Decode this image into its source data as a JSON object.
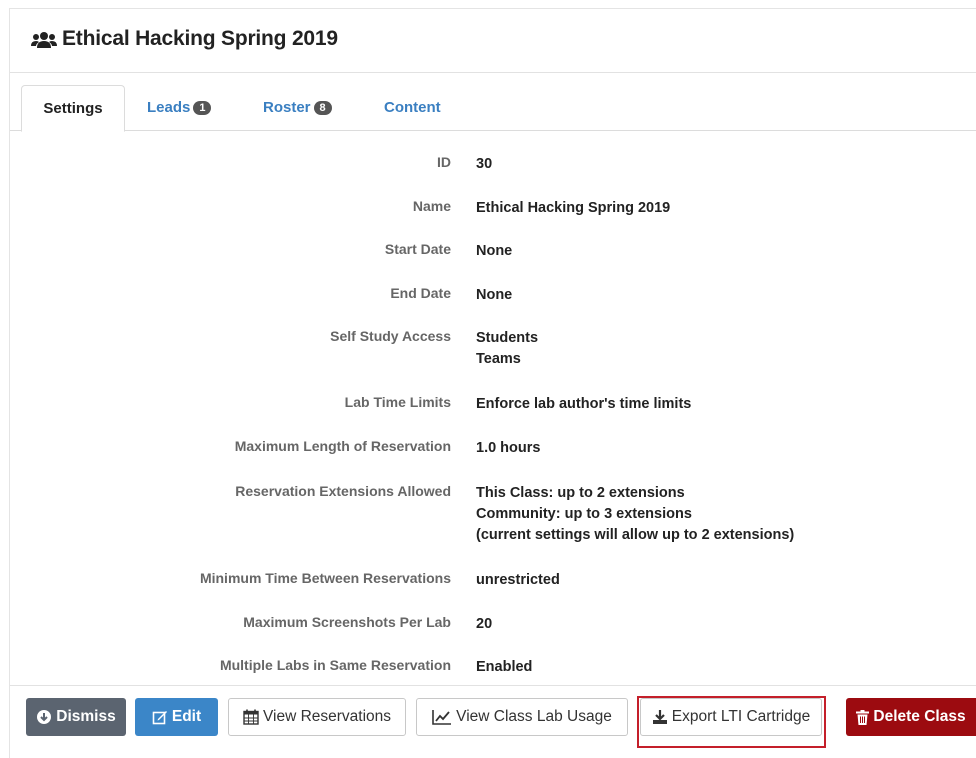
{
  "header": {
    "title": "Ethical Hacking Spring 2019",
    "icon": "users-icon"
  },
  "tabs": [
    {
      "label": "Settings",
      "active": true
    },
    {
      "label": "Leads",
      "badge": "1"
    },
    {
      "label": "Roster",
      "badge": "8"
    },
    {
      "label": "Content"
    }
  ],
  "settings": {
    "id": {
      "label": "ID",
      "value": "30"
    },
    "name": {
      "label": "Name",
      "value": "Ethical Hacking Spring 2019"
    },
    "start_date": {
      "label": "Start Date",
      "value": "None"
    },
    "end_date": {
      "label": "End Date",
      "value": "None"
    },
    "self_study": {
      "label": "Self Study Access",
      "values": [
        "Students",
        "Teams"
      ]
    },
    "lab_time_limits": {
      "label": "Lab Time Limits",
      "value": "Enforce lab author's time limits"
    },
    "max_length": {
      "label": "Maximum Length of Reservation",
      "value": "1.0 hours"
    },
    "extensions": {
      "label": "Reservation Extensions Allowed",
      "values": [
        "This Class: up to 2 extensions",
        "Community: up to 3 extensions",
        "(current settings will allow up to 2 extensions)"
      ]
    },
    "min_time": {
      "label": "Minimum Time Between Reservations",
      "value": "unrestricted"
    },
    "max_screenshots": {
      "label": "Maximum Screenshots Per Lab",
      "value": "20"
    },
    "multiple_labs": {
      "label": "Multiple Labs in Same Reservation",
      "value": "Enabled"
    }
  },
  "buttons": {
    "dismiss": "Dismiss",
    "edit": "Edit",
    "view_reservations": "View Reservations",
    "view_usage": "View Class Lab Usage",
    "export_lti": "Export LTI Cartridge",
    "delete": "Delete Class"
  },
  "colors": {
    "link": "#3a7fc1",
    "dismiss": "#5b6470",
    "edit": "#3b86c8",
    "delete": "#9c0b10",
    "highlight": "#c41f2a"
  }
}
